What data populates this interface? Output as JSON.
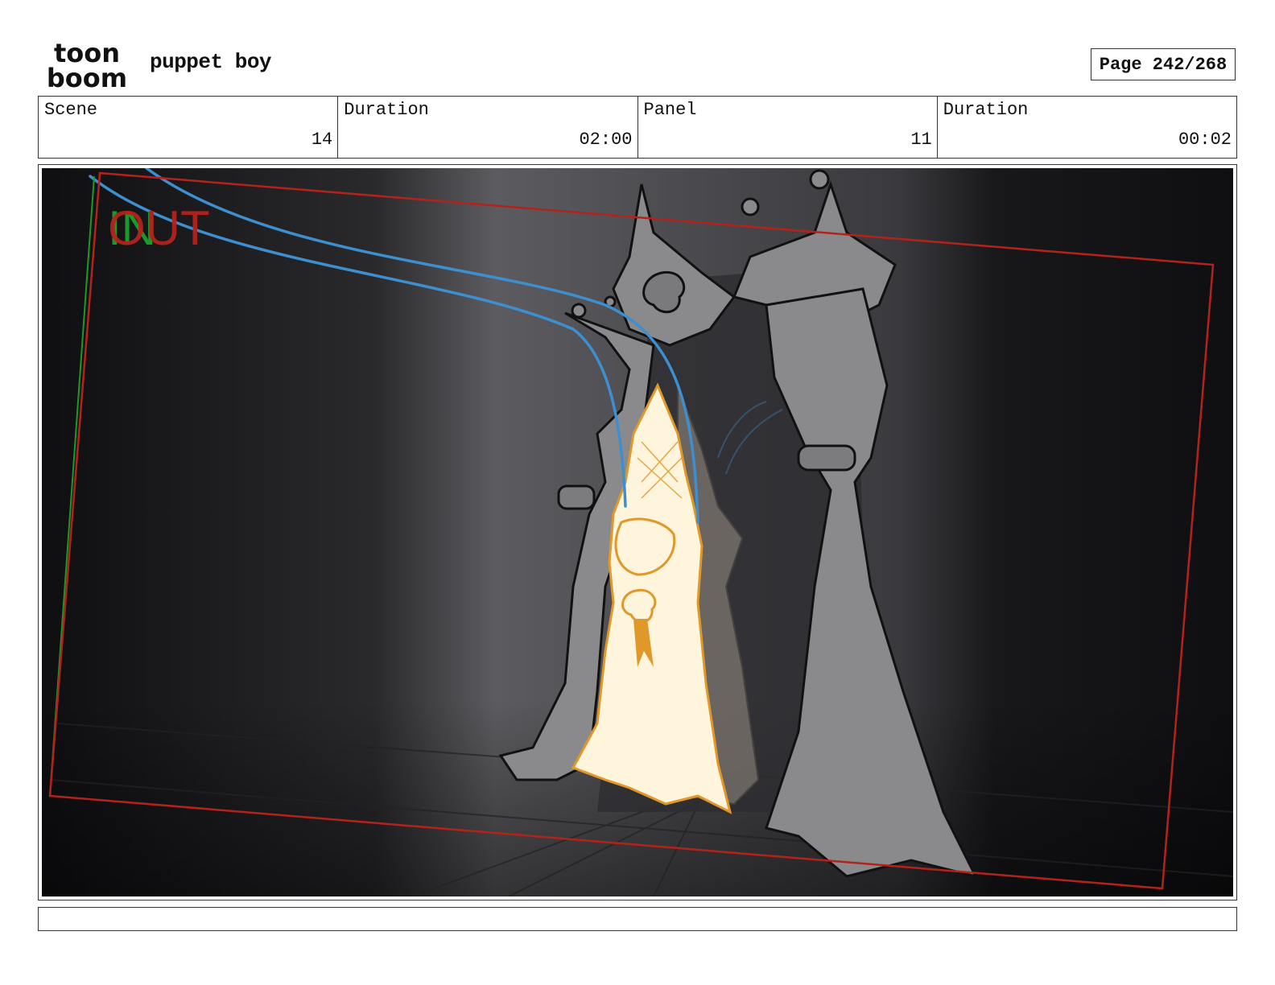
{
  "header": {
    "logo_line1": "toon",
    "logo_line2": "boom",
    "project_title": "puppet boy",
    "page_label": "Page 242/268"
  },
  "info_bar": [
    {
      "label": "Scene",
      "value": "14"
    },
    {
      "label": "Duration",
      "value": "02:00"
    },
    {
      "label": "Panel",
      "value": "11"
    },
    {
      "label": "Duration",
      "value": "00:02"
    }
  ],
  "panel": {
    "in_marker": "IN",
    "out_marker": "OUT",
    "colors": {
      "background": "#0f0f12",
      "light_beam": "#5a5a5e",
      "curtain": "#8a8a8c",
      "puppet_fill": "#fff4dc",
      "puppet_line": "#e0982a",
      "strings": "#3d8fcf",
      "camera_frame": "#b3221d",
      "in_frame": "#1a9a2a"
    }
  },
  "caption": ""
}
